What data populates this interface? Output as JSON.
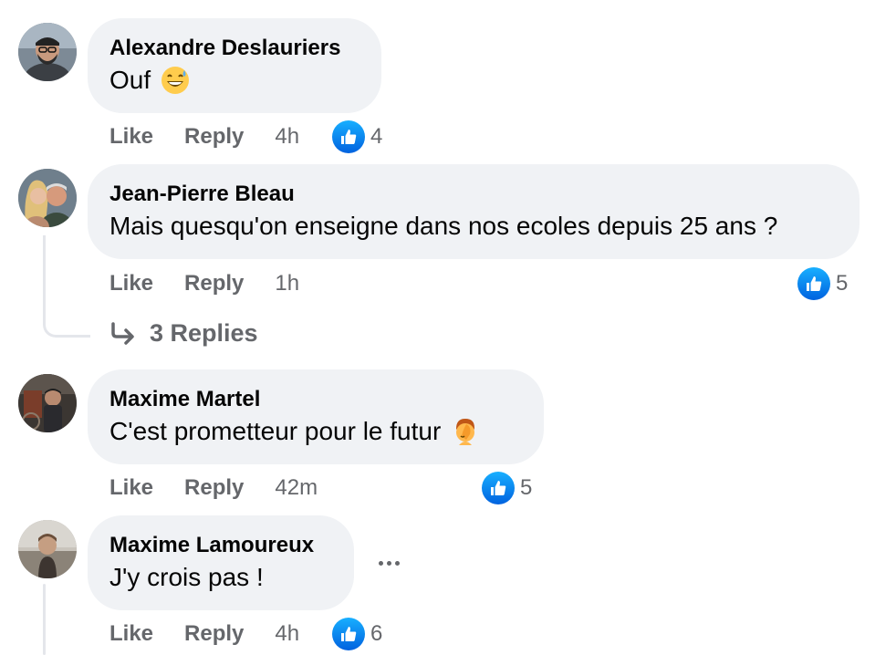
{
  "comments": [
    {
      "author": "Alexandre Deslauriers",
      "text": "Ouf",
      "emoji": "grinning-sweat-emoji",
      "like_label": "Like",
      "reply_label": "Reply",
      "time": "4h",
      "reaction_icon": "thumbs-up-icon",
      "reaction_count": "4"
    },
    {
      "author": "Jean-Pierre Bleau",
      "text": "Mais quesqu'on enseigne dans nos ecoles depuis 25 ans ?",
      "like_label": "Like",
      "reply_label": "Reply",
      "time": "1h",
      "reaction_icon": "thumbs-up-icon",
      "reaction_count": "5",
      "replies_label": "3 Replies"
    },
    {
      "author": "Maxime Martel",
      "text": "C'est prometteur pour le futur",
      "emoji": "face-palm-emoji",
      "like_label": "Like",
      "reply_label": "Reply",
      "time": "42m",
      "reaction_icon": "thumbs-up-icon",
      "reaction_count": "5"
    },
    {
      "author": "Maxime Lamoureux",
      "text": "J'y crois pas !",
      "like_label": "Like",
      "reply_label": "Reply",
      "time": "4h",
      "reaction_icon": "thumbs-up-icon",
      "reaction_count": "6",
      "more_icon": "more-options-icon"
    }
  ],
  "colors": {
    "bubble_bg": "#f0f2f5",
    "secondary_text": "#65676b",
    "like_blue": "#0866ff",
    "thread_line": "#e4e6eb"
  }
}
